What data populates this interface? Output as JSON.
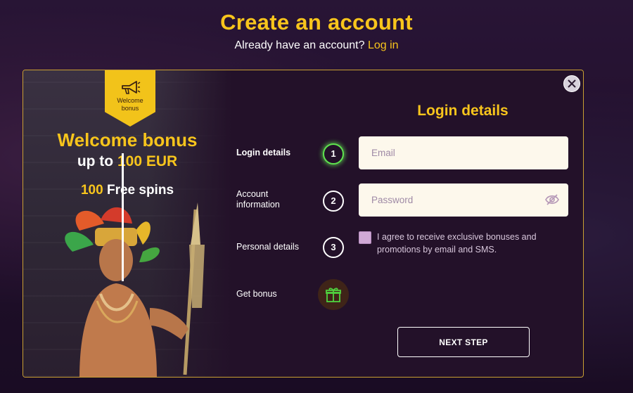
{
  "header": {
    "title": "Create an account",
    "subtitle": "Already have an account?",
    "login_link": "Log in"
  },
  "promo": {
    "badge_label_line1": "Welcome",
    "badge_label_line2": "bonus",
    "title": "Welcome bonus",
    "sub_prefix": "up to",
    "sub_amount": "100 EUR",
    "spins_count": "100",
    "spins_label": "Free spins"
  },
  "steps": [
    {
      "label": "Login details",
      "number": "1",
      "state": "active"
    },
    {
      "label_line1": "Account",
      "label_line2": "information",
      "number": "2",
      "state": "pending"
    },
    {
      "label": "Personal details",
      "number": "3",
      "state": "pending"
    },
    {
      "label": "Get bonus",
      "icon": "gift-icon"
    }
  ],
  "form": {
    "title": "Login details",
    "email_placeholder": "Email",
    "email_value": "",
    "password_placeholder": "Password",
    "password_value": "",
    "consent_text": "I agree to receive exclusive bonuses and promotions by email and SMS.",
    "consent_checked": false,
    "next_button": "NEXT STEP"
  },
  "colors": {
    "accent": "#f8c51c",
    "active_step": "#5fe34f",
    "modal_bg": "#231129"
  }
}
